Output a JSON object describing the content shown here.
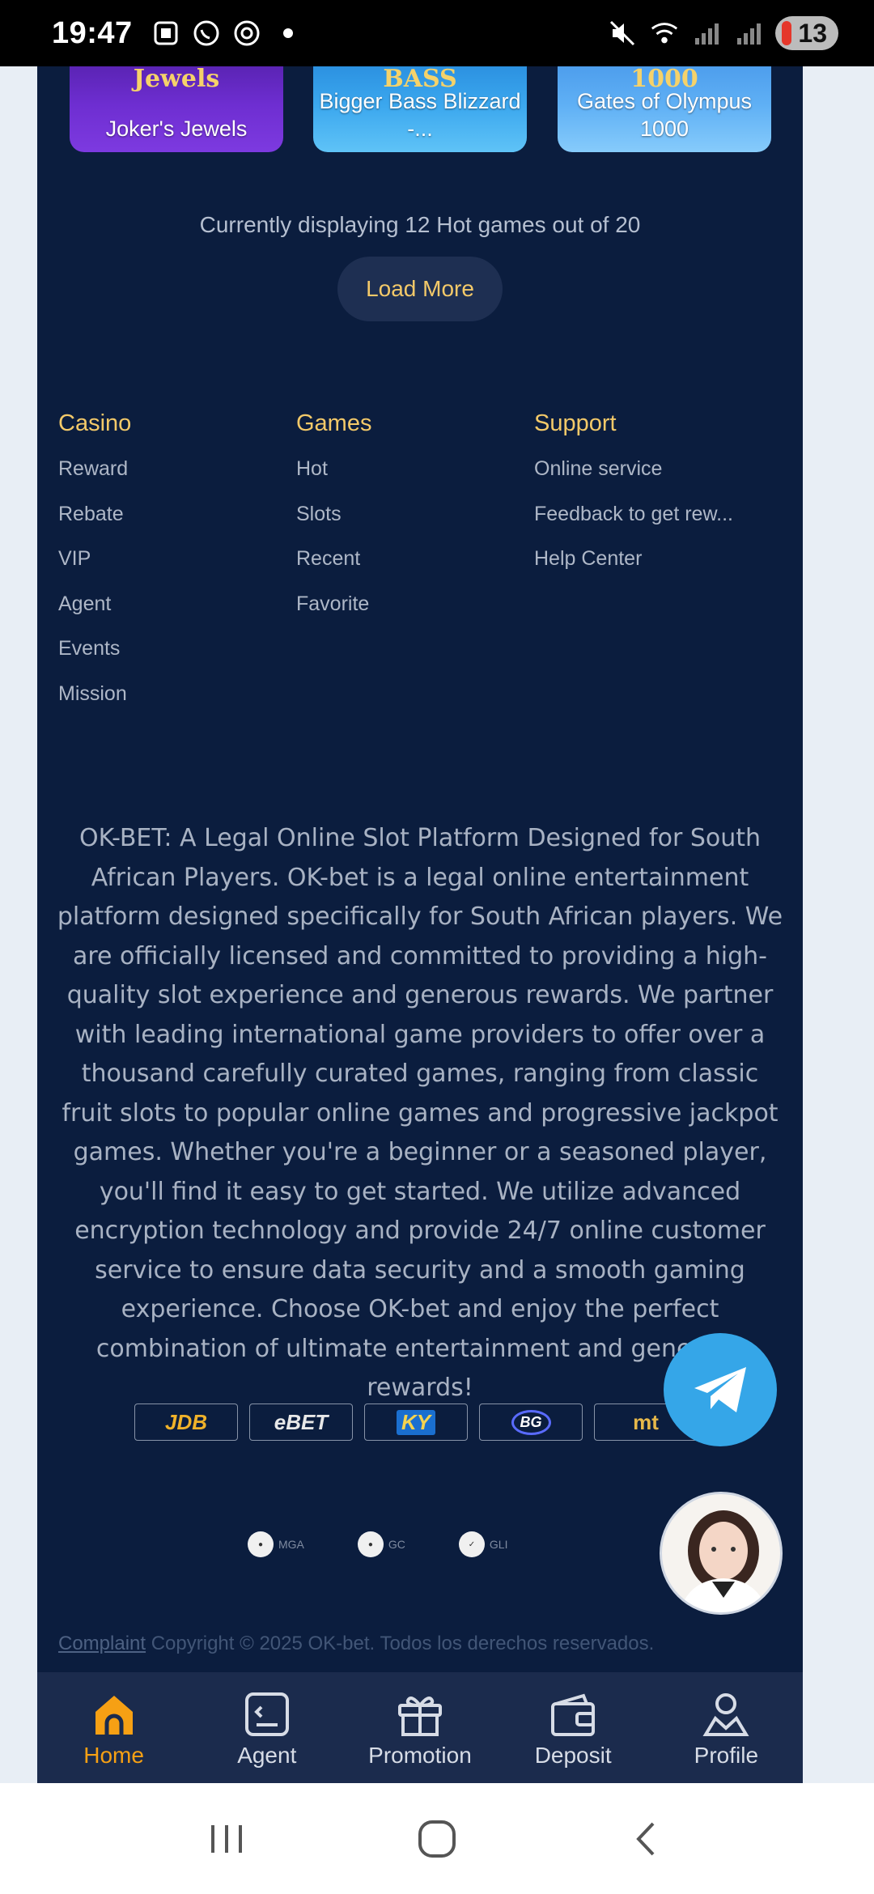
{
  "status_bar": {
    "time": "19:47",
    "battery": "13"
  },
  "games": [
    {
      "name": "Joker's Jewels",
      "art_text": "Jewels"
    },
    {
      "name": "Bigger Bass Blizzard -...",
      "art_text": "BASS"
    },
    {
      "name": "Gates of Olympus 1000",
      "art_text": "1000"
    }
  ],
  "count_text": "Currently displaying 12 Hot games out of 20",
  "load_more": "Load More",
  "footer": {
    "casino": {
      "title": "Casino",
      "links": [
        "Reward",
        "Rebate",
        "VIP",
        "Agent",
        "Events",
        "Mission"
      ]
    },
    "games": {
      "title": "Games",
      "links": [
        "Hot",
        "Slots",
        "Recent",
        "Favorite"
      ]
    },
    "support": {
      "title": "Support",
      "links": [
        "Online service",
        "Feedback to get rew...",
        "Help Center"
      ]
    }
  },
  "about": "OK-BET: A Legal Online Slot Platform Designed for South African Players. OK-bet is a legal online entertainment platform designed specifically for South African players. We are officially licensed and committed to providing a high-quality slot experience and generous rewards. We partner with leading international game providers to offer over a thousand carefully curated games, ranging from classic fruit slots to popular online games and progressive jackpot games. Whether you're a beginner or a seasoned player, you'll find it easy to get started. We utilize advanced encryption technology and provide 24/7 online customer service to ensure data security and a smooth gaming experience. Choose OK-bet and enjoy the perfect combination of ultimate entertainment and generous rewards!",
  "providers": [
    "JDB",
    "eBET",
    "KY",
    "BG",
    "mt"
  ],
  "certs": [
    "MGA",
    "GC",
    "GLI"
  ],
  "copyright": {
    "complaint": "Complaint",
    "text": " Copyright © 2025 OK-bet. Todos los derechos reservados."
  },
  "nav": {
    "home": "Home",
    "agent": "Agent",
    "promotion": "Promotion",
    "deposit": "Deposit",
    "profile": "Profile"
  },
  "colors": {
    "accent": "#f3c969",
    "active_nav": "#f6a014",
    "background": "#0b1d3e",
    "nav_bg": "#1b2b4d",
    "telegram": "#35a6e8"
  }
}
